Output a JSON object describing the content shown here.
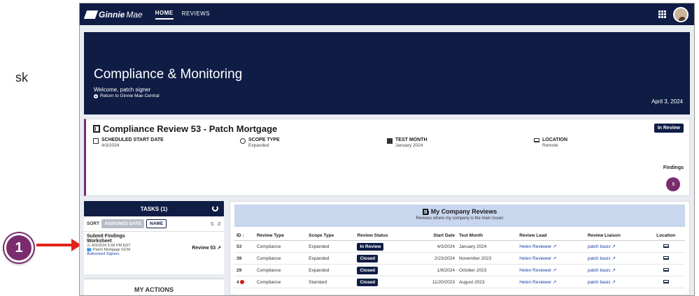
{
  "annotation": {
    "side_text": "sk",
    "callout_number": "1"
  },
  "app": {
    "brand": "Ginnie",
    "brand_suffix": "Mae",
    "nav": [
      {
        "label": "HOME",
        "active": true
      },
      {
        "label": "REVIEWS",
        "active": false
      }
    ]
  },
  "hero": {
    "title": "Compliance & Monitoring",
    "welcome": "Welcome, patch signer",
    "return_link": "Return to Ginnie Mae Central",
    "date": "April 3, 2024"
  },
  "review": {
    "title": "Compliance Review 53 - Patch Mortgage",
    "status": "In Review",
    "meta": [
      {
        "label": "SCHEDULED START DATE",
        "value": "4/3/2024",
        "icon": "calendar-check-icon"
      },
      {
        "label": "SCOPE TYPE",
        "value": "Expanded",
        "icon": "search-icon"
      },
      {
        "label": "TEST MONTH",
        "value": "January 2024",
        "icon": "calendar-icon"
      },
      {
        "label": "LOCATION",
        "value": "Remote",
        "icon": "laptop-icon"
      }
    ],
    "findings_label": "Findings",
    "findings_count": "6"
  },
  "tasks": {
    "header": "TASKS (1)",
    "sort_label": "SORT",
    "sort_assigned": "ASSIGNED DATE",
    "sort_name": "NAME",
    "item": {
      "title1": "Submit Findings",
      "title2": "Worksheet",
      "date": "4/3/2024 5:58 PM EDT",
      "company": "Patch Mortgage GCM",
      "review_link": "Review 53 ↗",
      "auth": "Authorized Signers"
    },
    "my_actions": "MY ACTIONS"
  },
  "company": {
    "title": "My Company Reviews",
    "subtitle": "Reviews where my company is the main Issuer",
    "columns": [
      "ID ↓",
      "Review Type",
      "Scope Type",
      "Review Status",
      "Start Date",
      "Test Month",
      "Review Lead",
      "Review Liaison",
      "Location"
    ],
    "rows": [
      {
        "id": "53",
        "type": "Compliance",
        "scope": "Expanded",
        "status": "In Review",
        "start": "4/3/2024",
        "month": "January 2024",
        "lead": "Helen Reviewer ↗",
        "liaison": "patch basic ↗",
        "err": false
      },
      {
        "id": "39",
        "type": "Compliance",
        "scope": "Expanded",
        "status": "Closed",
        "start": "2/23/2024",
        "month": "November 2023",
        "lead": "Helen Reviewer ↗",
        "liaison": "patch basic ↗",
        "err": false
      },
      {
        "id": "29",
        "type": "Compliance",
        "scope": "Expanded",
        "status": "Closed",
        "start": "1/8/2024",
        "month": "October 2023",
        "lead": "Helen Reviewer ↗",
        "liaison": "patch basic ↗",
        "err": false
      },
      {
        "id": "4",
        "type": "Compliance",
        "scope": "Standard",
        "status": "Closed",
        "start": "11/20/2023",
        "month": "August 2023",
        "lead": "Helen Reviewer ↗",
        "liaison": "patch basic ↗",
        "err": true
      }
    ]
  }
}
